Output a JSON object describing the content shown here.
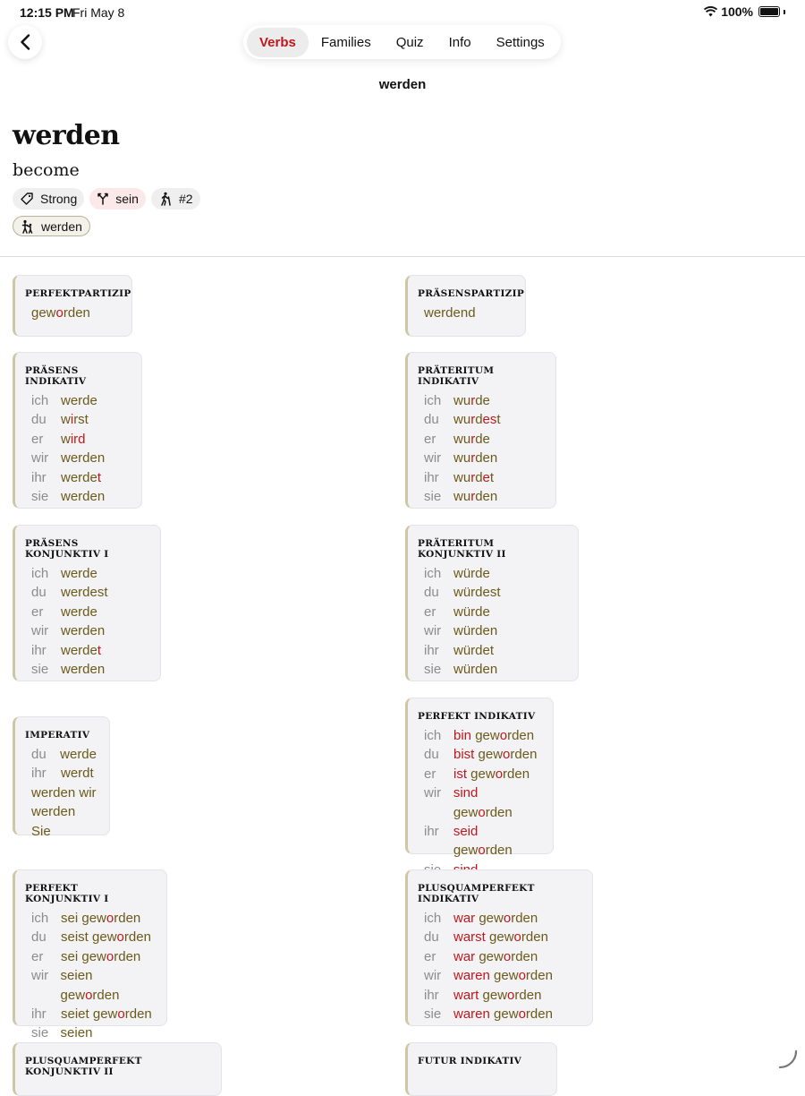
{
  "status_bar": {
    "time": "12:15 PM",
    "date": "Fri May 8",
    "battery": "100%"
  },
  "nav": {
    "tabs": [
      "Verbs",
      "Families",
      "Quiz",
      "Info",
      "Settings"
    ],
    "active_tab": "Verbs",
    "title": "werden"
  },
  "verb": {
    "infinitive": "werden",
    "meaning": "become",
    "chips": [
      {
        "icon": "tag-icon",
        "label": "Strong"
      },
      {
        "icon": "fork-icon",
        "label": "sein"
      },
      {
        "icon": "hiker-icon",
        "label": "#2"
      }
    ],
    "family_chip": {
      "icon": "family-icon",
      "label": "werden"
    }
  },
  "colors": {
    "accent": "#c0171c",
    "form_text": "#6b5a1a",
    "pronoun": "#8c8c8c",
    "card_bg": "#f3f3f6",
    "card_border": "#cfc7a4"
  },
  "tables": {
    "perfektpartizip": {
      "title": "PERFEKTPARTIZIP",
      "form": "geworden"
    },
    "praesenspartizip": {
      "title": "PRÄSENSPARTIZIP",
      "form": "werdend"
    },
    "praesens_indikativ": {
      "title": "PRÄSENS INDIKATIV",
      "rows": [
        {
          "p": "ich",
          "f": "werde"
        },
        {
          "p": "du",
          "f": "wirst"
        },
        {
          "p": "er",
          "f": "wird"
        },
        {
          "p": "wir",
          "f": "werden"
        },
        {
          "p": "ihr",
          "f": "werdet"
        },
        {
          "p": "sie",
          "f": "werden"
        }
      ]
    },
    "praeteritum_indikativ": {
      "title": "PRÄTERITUM INDIKATIV",
      "rows": [
        {
          "p": "ich",
          "f": "wurde"
        },
        {
          "p": "du",
          "f": "wurdest"
        },
        {
          "p": "er",
          "f": "wurde"
        },
        {
          "p": "wir",
          "f": "wurden"
        },
        {
          "p": "ihr",
          "f": "wurdet"
        },
        {
          "p": "sie",
          "f": "wurden"
        }
      ]
    },
    "praesens_konjunktiv_1": {
      "title": "PRÄSENS KONJUNKTIV I",
      "rows": [
        {
          "p": "ich",
          "f": "werde"
        },
        {
          "p": "du",
          "f": "werdest"
        },
        {
          "p": "er",
          "f": "werde"
        },
        {
          "p": "wir",
          "f": "werden"
        },
        {
          "p": "ihr",
          "f": "werdet"
        },
        {
          "p": "sie",
          "f": "werden"
        }
      ]
    },
    "praeteritum_konjunktiv_2": {
      "title": "PRÄTERITUM KONJUNKTIV II",
      "rows": [
        {
          "p": "ich",
          "f": "würde"
        },
        {
          "p": "du",
          "f": "würdest"
        },
        {
          "p": "er",
          "f": "würde"
        },
        {
          "p": "wir",
          "f": "würden"
        },
        {
          "p": "ihr",
          "f": "würdet"
        },
        {
          "p": "sie",
          "f": "würden"
        }
      ]
    },
    "imperativ": {
      "title": "IMPERATIV",
      "rows": [
        {
          "p": "du",
          "f": "werde"
        },
        {
          "p": "ihr",
          "f": "werdt"
        },
        {
          "p": "",
          "f": "werden wir"
        },
        {
          "p": "",
          "f": "werden Sie"
        }
      ]
    },
    "perfekt_indikativ": {
      "title": "PERFEKT INDIKATIV",
      "rows": [
        {
          "p": "ich",
          "f": "bin geworden"
        },
        {
          "p": "du",
          "f": "bist geworden"
        },
        {
          "p": "er",
          "f": "ist geworden"
        },
        {
          "p": "wir",
          "f": "sind geworden"
        },
        {
          "p": "ihr",
          "f": "seid geworden"
        },
        {
          "p": "sie",
          "f": "sind geworden"
        }
      ]
    },
    "perfekt_konjunktiv_1": {
      "title": "PERFEKT KONJUNKTIV I",
      "rows": [
        {
          "p": "ich",
          "f": "sei geworden"
        },
        {
          "p": "du",
          "f": "seist geworden"
        },
        {
          "p": "er",
          "f": "sei geworden"
        },
        {
          "p": "wir",
          "f": "seien geworden"
        },
        {
          "p": "ihr",
          "f": "seiet geworden"
        },
        {
          "p": "sie",
          "f": "seien geworden"
        }
      ]
    },
    "plusquamperfekt_indikativ": {
      "title": "PLUSQUAMPERFEKT INDIKATIV",
      "rows": [
        {
          "p": "ich",
          "f": "war geworden"
        },
        {
          "p": "du",
          "f": "warst geworden"
        },
        {
          "p": "er",
          "f": "war geworden"
        },
        {
          "p": "wir",
          "f": "waren geworden"
        },
        {
          "p": "ihr",
          "f": "wart geworden"
        },
        {
          "p": "sie",
          "f": "waren geworden"
        }
      ]
    },
    "plusquamperfekt_konjunktiv_2": {
      "title": "PLUSQUAMPERFEKT KONJUNKTIV II"
    },
    "futur_indikativ": {
      "title": "FUTUR INDIKATIV"
    }
  }
}
